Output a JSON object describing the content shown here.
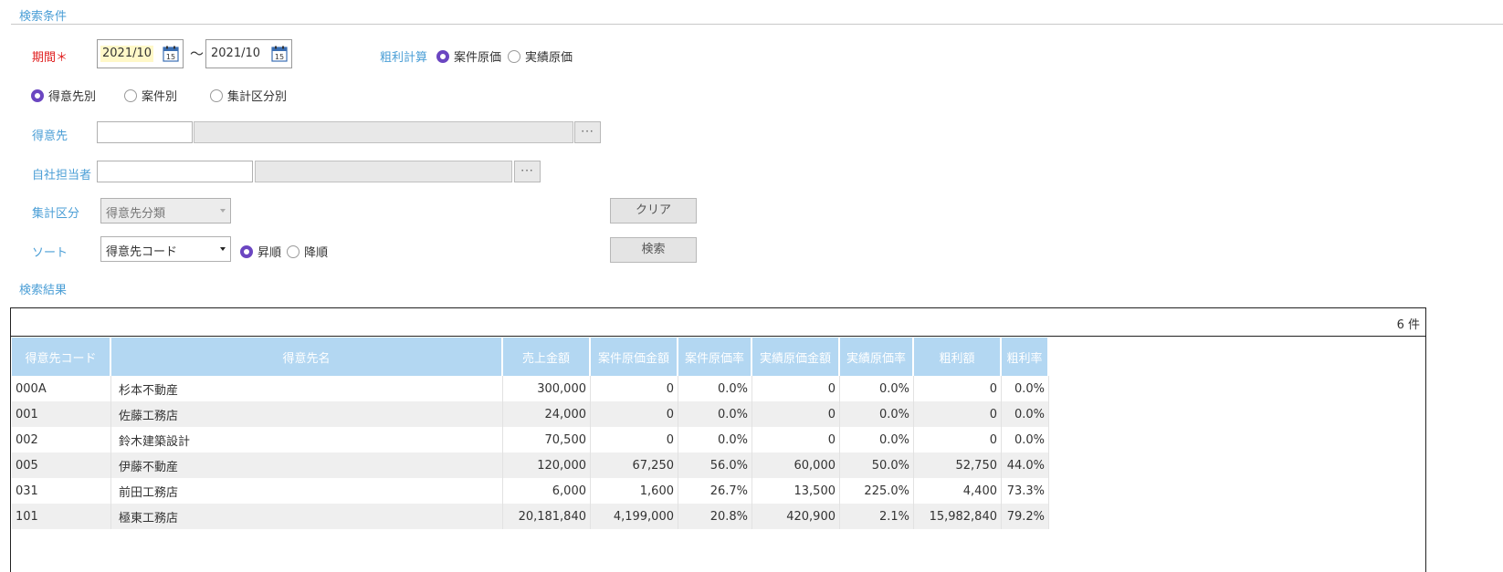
{
  "search_conditions": {
    "title": "検索条件",
    "period": {
      "label": "期間",
      "required_mark": "＊",
      "from": "2021/10",
      "to": "2021/10",
      "separator": "～"
    },
    "gross_profit_calc": {
      "label": "粗利計算",
      "options": [
        "案件原価",
        "実績原価"
      ],
      "selected": "案件原価"
    },
    "group_by": {
      "options": [
        "得意先別",
        "案件別",
        "集計区分別"
      ],
      "selected": "得意先別"
    },
    "customer": {
      "label": "得意先",
      "code_value": "",
      "name_value": "",
      "lookup_label": "···"
    },
    "staff": {
      "label": "自社担当者",
      "code_value": "",
      "name_value": "",
      "lookup_label": "···"
    },
    "aggregation": {
      "label": "集計区分",
      "selected": "得意先分類"
    },
    "sort": {
      "label": "ソート",
      "selected": "得意先コード",
      "order_options": [
        "昇順",
        "降順"
      ],
      "order_selected": "昇順"
    },
    "clear_button": "クリア",
    "search_button": "検索"
  },
  "results": {
    "title": "検索結果",
    "count_text": "6 件",
    "columns": [
      "得意先コード",
      "得意先名",
      "売上金額",
      "案件原価金額",
      "案件原価率",
      "実績原価金額",
      "実績原価率",
      "粗利額",
      "粗利率"
    ],
    "rows": [
      [
        "000A",
        "杉本不動産",
        "300,000",
        "0",
        "0.0%",
        "0",
        "0.0%",
        "0",
        "0.0%"
      ],
      [
        "001",
        "佐藤工務店",
        "24,000",
        "0",
        "0.0%",
        "0",
        "0.0%",
        "0",
        "0.0%"
      ],
      [
        "002",
        "鈴木建築設計",
        "70,500",
        "0",
        "0.0%",
        "0",
        "0.0%",
        "0",
        "0.0%"
      ],
      [
        "005",
        "伊藤不動産",
        "120,000",
        "67,250",
        "56.0%",
        "60,000",
        "50.0%",
        "52,750",
        "44.0%"
      ],
      [
        "031",
        "前田工務店",
        "6,000",
        "1,600",
        "26.7%",
        "13,500",
        "225.0%",
        "4,400",
        "73.3%"
      ],
      [
        "101",
        "極東工務店",
        "20,181,840",
        "4,199,000",
        "20.8%",
        "420,900",
        "2.1%",
        "15,982,840",
        "79.2%"
      ]
    ]
  },
  "colors": {
    "label_blue": "#4a9ed6",
    "required_red": "#e02020",
    "header_bg": "#b3d7f2",
    "radio_accent": "#6b46c1",
    "date_highlight": "#fff8c8"
  },
  "icons": {
    "calendar": "calendar-icon",
    "lookup": "ellipsis-icon",
    "dropdown": "chevron-down-icon"
  }
}
